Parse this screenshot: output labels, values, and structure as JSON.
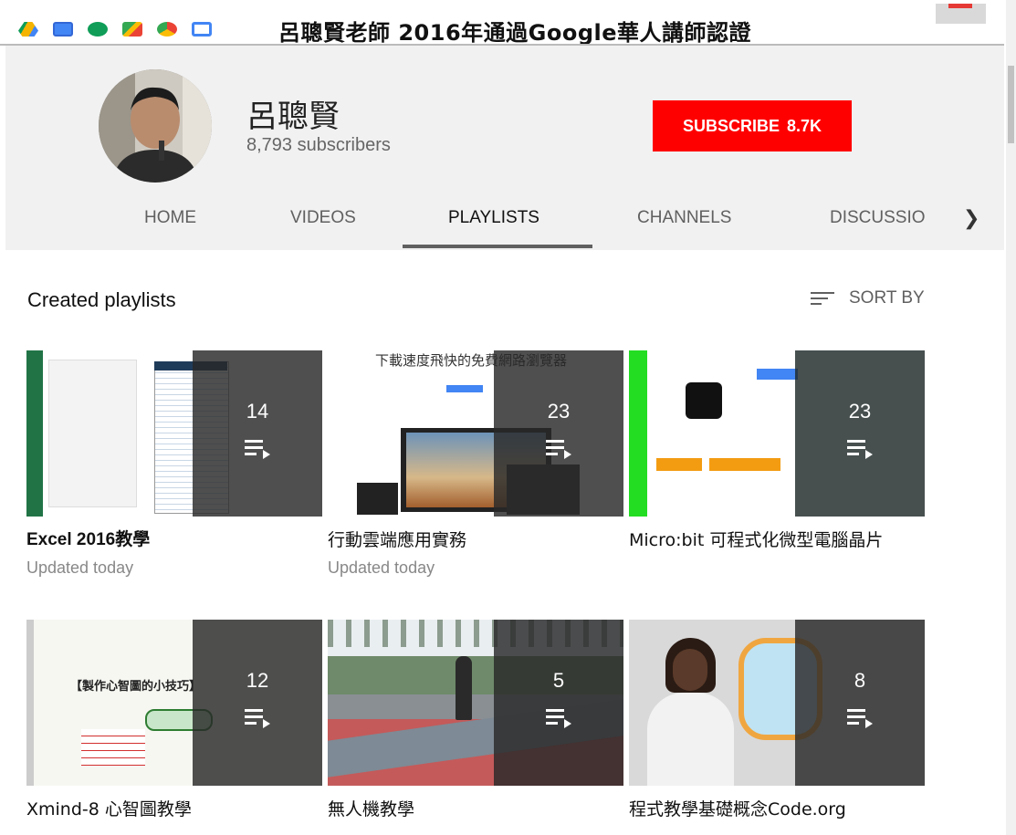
{
  "banner": {
    "title": "呂聰賢老師 2016年通過Google華人講師認證",
    "app_icons": [
      "google-drive-icon",
      "google-calendar-icon",
      "google-hangouts-icon",
      "google-maps-icon",
      "chrome-icon",
      "search-console-icon"
    ]
  },
  "channel": {
    "name": "呂聰賢",
    "subscribers": "8,793 subscribers",
    "subscribe_label": "SUBSCRIBE",
    "subscribe_count": "8.7K"
  },
  "tabs": [
    {
      "label": "HOME"
    },
    {
      "label": "VIDEOS"
    },
    {
      "label": "PLAYLISTS"
    },
    {
      "label": "CHANNELS"
    },
    {
      "label": "DISCUSSIO"
    }
  ],
  "section": {
    "title": "Created playlists",
    "sort_label": "SORT BY"
  },
  "playlists": [
    {
      "title": "Excel 2016教學",
      "count": "14",
      "updated": "Updated today",
      "thumb_text": ""
    },
    {
      "title": "行動雲端應用實務",
      "count": "23",
      "updated": "Updated today",
      "thumb_text": "下載速度飛快的免費網路瀏覽器"
    },
    {
      "title": "Micro:bit 可程式化微型電腦晶片",
      "count": "23",
      "updated": "",
      "thumb_text": ""
    },
    {
      "title": "Xmind-8 心智圖教學",
      "count": "12",
      "updated": "",
      "thumb_text": "【製作心智圖的小技巧】"
    },
    {
      "title": "無人機教學",
      "count": "5",
      "updated": "",
      "thumb_text": ""
    },
    {
      "title": "程式教學基礎概念Code.org",
      "count": "8",
      "updated": "",
      "thumb_text": ""
    }
  ],
  "colors": {
    "subscribe": "#ff0000",
    "header_bg": "#f1f1f1",
    "muted_text": "#606060"
  }
}
